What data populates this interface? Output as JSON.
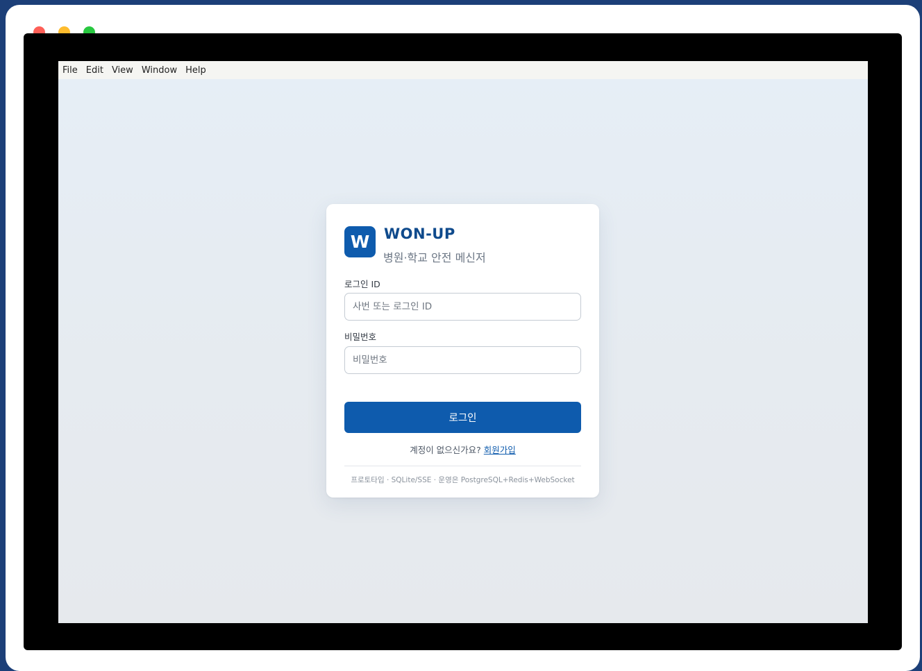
{
  "menubar": {
    "items": [
      "File",
      "Edit",
      "View",
      "Window",
      "Help"
    ]
  },
  "brand": {
    "logo_letter": "W",
    "title": "WON-UP",
    "subtitle": "병원·학교 안전 메신저"
  },
  "form": {
    "login_id_label": "로그인 ID",
    "login_id_placeholder": "사번 또는 로그인 ID",
    "password_label": "비밀번호",
    "password_placeholder": "비밀번호",
    "login_button": "로그인"
  },
  "signup": {
    "prompt": "계정이 없으신가요?",
    "link": "회원가입"
  },
  "footer": {
    "note": "프로토타입 · SQLite/SSE · 운영은 PostgreSQL+Redis+WebSocket"
  },
  "colors": {
    "brand_primary": "#0e5bad",
    "brand_title": "#0f4a8c",
    "desktop_background": "#1c3f78"
  }
}
